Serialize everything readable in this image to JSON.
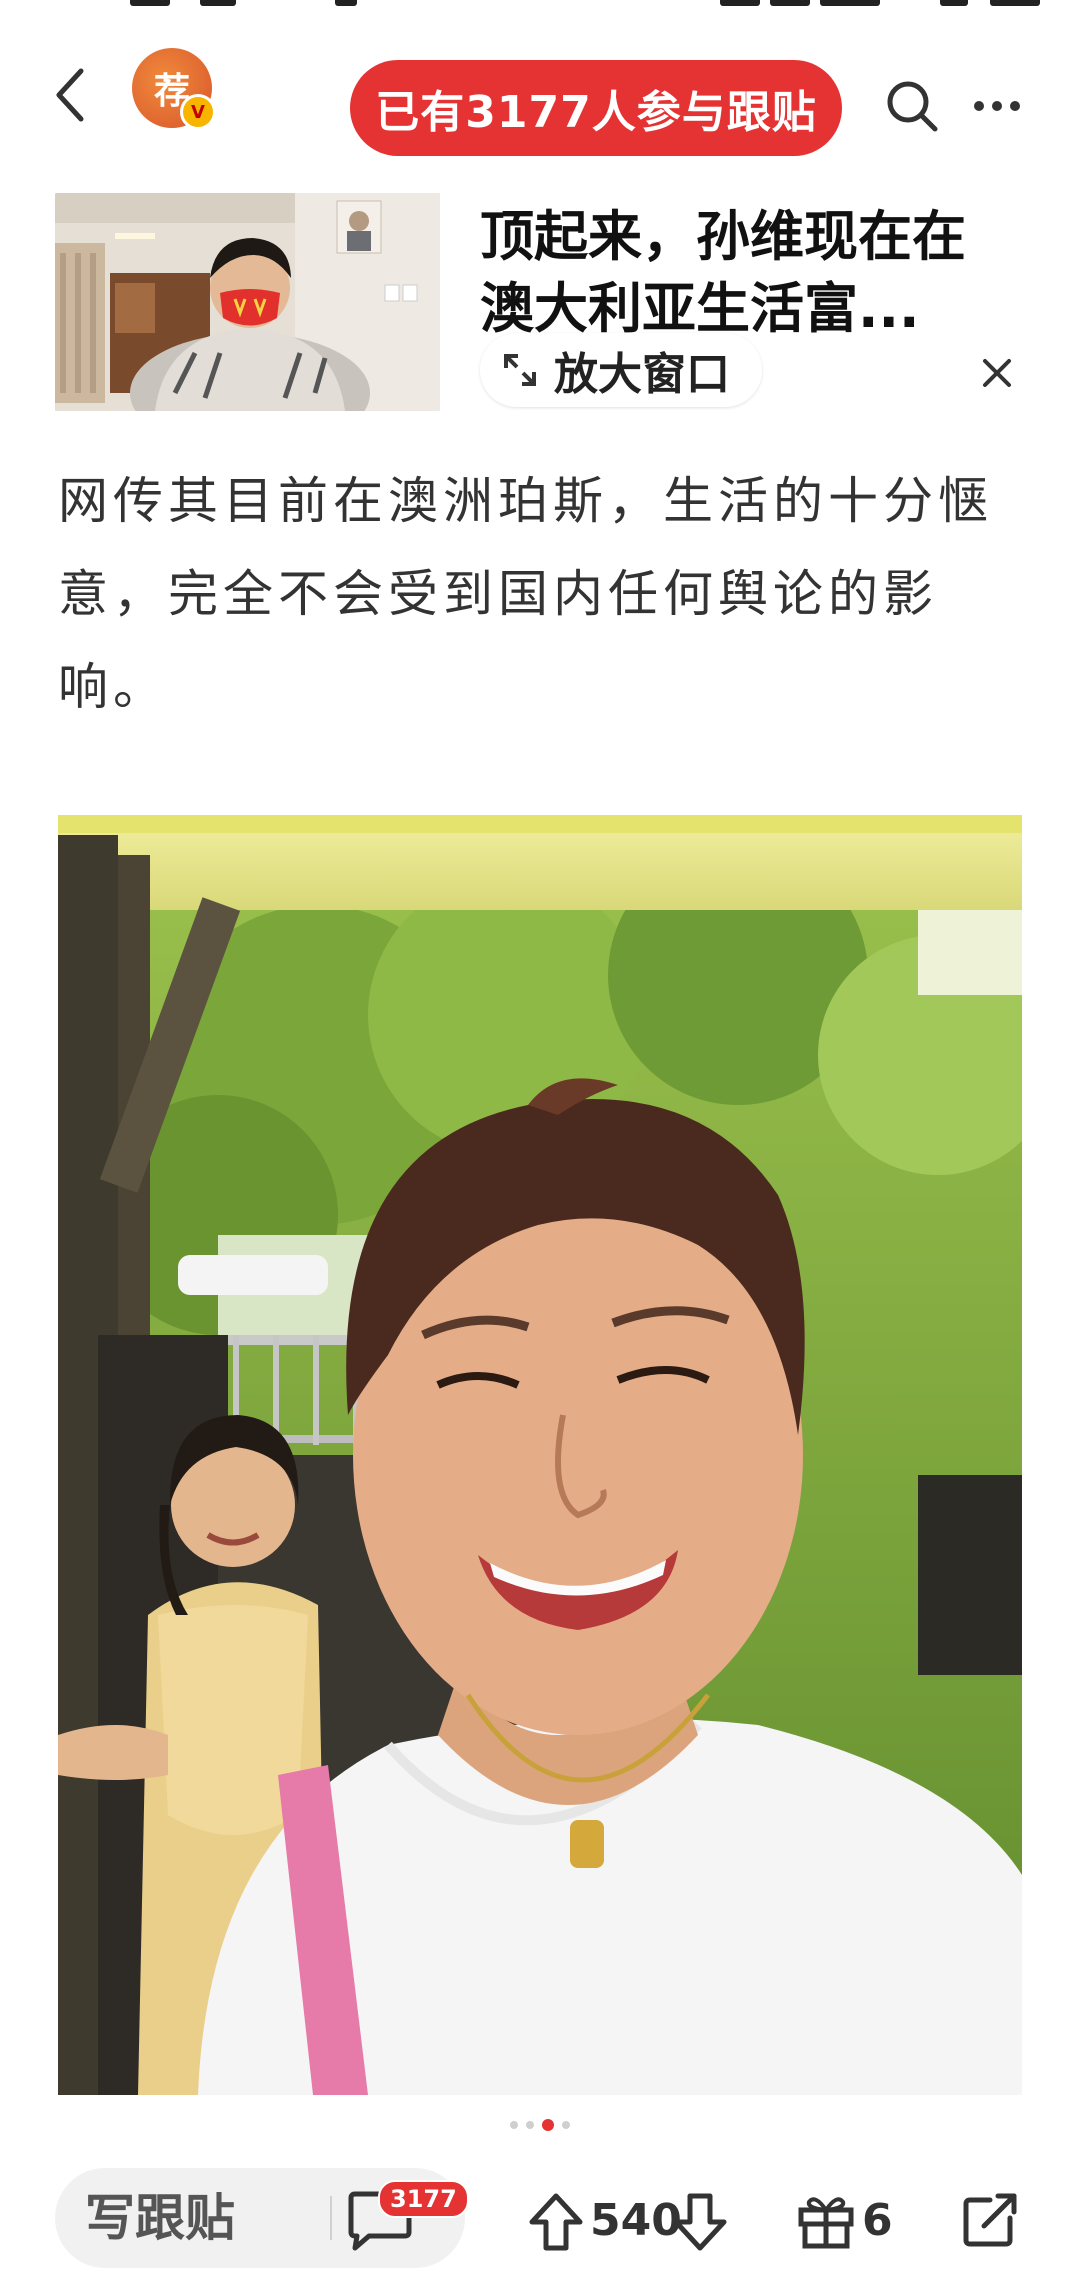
{
  "header": {
    "back_icon": "chevron-left-icon",
    "avatar_char": "荐",
    "avatar_badge": "V",
    "participate_label": "已有3177人参与跟贴",
    "search_icon": "search-icon",
    "more_icon": "more-icon"
  },
  "linked_article": {
    "title": "顶起来，孙维现在在\n澳大利亚生活富...",
    "enlarge_label": "放大窗口",
    "enlarge_icon": "expand-icon",
    "close_icon": "close-icon"
  },
  "article": {
    "paragraph": "网传其目前在澳洲珀斯，生活的十分惬意，完全不会受到国内任何舆论的影响。"
  },
  "carousel": {
    "total": 4,
    "active_index": 2
  },
  "bottom_bar": {
    "write_reply_label": "写跟贴",
    "comment_count": "3177",
    "upvote_count": "540",
    "gift_count": "6",
    "icons": [
      "comment-icon",
      "upvote-icon",
      "downvote-icon",
      "gift-icon",
      "share-icon"
    ]
  },
  "colors": {
    "accent": "#e53232",
    "text": "#333333",
    "bar_bg": "#f1f1f1"
  }
}
